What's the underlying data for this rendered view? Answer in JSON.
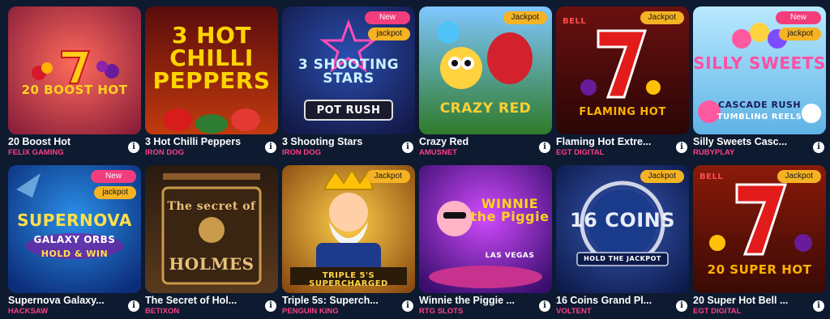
{
  "colors": {
    "background": "#0d1a30",
    "provider": "#ff3f86",
    "badge_new": "#f23d7d",
    "badge_jackpot": "#f5b323"
  },
  "badges": {
    "new": "New",
    "jackpot_lower": "jackpot",
    "jackpot_upper": "Jackpot"
  },
  "info_label": "i",
  "games": [
    {
      "title": "20 Boost Hot",
      "provider": "FELIX GAMING",
      "art": "20 BOOST HOT",
      "icon": "cherry-seven-icon"
    },
    {
      "title": "3 Hot Chilli Peppers",
      "provider": "IRON DOG",
      "art": "3 HOT CHILLI PEPPERS",
      "icon": "chilli-icon"
    },
    {
      "title": "3 Shooting Stars",
      "provider": "IRON DOG",
      "art": "3 SHOOTING STARS",
      "art2": "POT RUSH",
      "icon": "star-icon"
    },
    {
      "title": "Crazy Red",
      "provider": "AMUSNET",
      "art": "CRAZY RED",
      "icon": "parrot-icon"
    },
    {
      "title": "Flaming Hot Extre...",
      "provider": "EGT DIGITAL",
      "art": "FLAMING HOT",
      "art2": "BELL",
      "icon": "seven-icon"
    },
    {
      "title": "Silly Sweets Casc...",
      "provider": "RUBYPLAY",
      "art": "SILLY SWEETS",
      "art2": "CASCADE RUSH",
      "art3": "TUMBLING REELS",
      "icon": "candy-icon"
    },
    {
      "title": "Supernova Galaxy...",
      "provider": "HACKSAW",
      "art": "SUPERNOVA",
      "art2": "GALAXY ORBS",
      "art3": "HOLD & WIN",
      "icon": "planet-icon"
    },
    {
      "title": "The Secret of Hol...",
      "provider": "BETIXON",
      "art": "The secret of",
      "art2": "HOLMES",
      "icon": "detective-icon"
    },
    {
      "title": "Triple 5s: Superch...",
      "provider": "PENGUIN KING",
      "art": "TRIPLE 5's SUPERCHARGED",
      "icon": "king-icon"
    },
    {
      "title": "Winnie the Piggie ...",
      "provider": "RTG SLOTS",
      "art": "WINNIE the Piggie",
      "art2": "LAS VEGAS",
      "icon": "pig-icon"
    },
    {
      "title": "16 Coins Grand Pl...",
      "provider": "VOLTENT",
      "art": "16 COINS",
      "art2": "HOLD THE JACKPOT",
      "icon": "coin-icon"
    },
    {
      "title": "20 Super Hot Bell ...",
      "provider": "EGT DIGITAL",
      "art": "20 SUPER HOT",
      "art2": "BELL",
      "icon": "seven-icon"
    }
  ]
}
